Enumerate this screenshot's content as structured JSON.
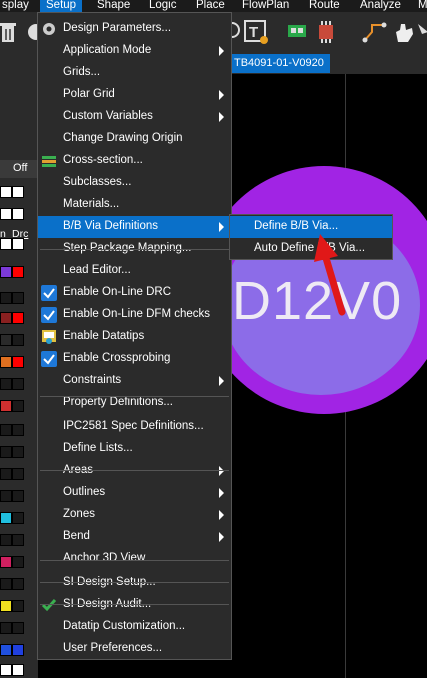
{
  "menubar": {
    "items": [
      "splay",
      "Setup",
      "Shape",
      "Logic",
      "Place",
      "FlowPlan",
      "Route",
      "Analyze",
      "M"
    ],
    "active_index": 1
  },
  "tab": {
    "label": "TB4091-01-V0920"
  },
  "left_panel": {
    "off_label": "Off",
    "header_left": "n",
    "header_right": "Drc"
  },
  "canvas": {
    "via_text": "D12V0"
  },
  "setup_menu": {
    "items": [
      {
        "label": "Design Parameters...",
        "icon": "gear-icon"
      },
      {
        "label": "Application Mode",
        "submenu": true
      },
      {
        "label": "Grids..."
      },
      {
        "label": "Polar Grid",
        "submenu": true
      },
      {
        "label": "Custom Variables",
        "submenu": true
      },
      {
        "label": "Change Drawing Origin"
      },
      {
        "label": "Cross-section...",
        "icon": "cross-section-icon"
      },
      {
        "label": "Subclasses..."
      },
      {
        "label": "Materials..."
      },
      {
        "label": "B/B Via Definitions",
        "submenu": true,
        "highlighted": true
      },
      {
        "label": "Step Package Mapping..."
      },
      {
        "label": "Lead Editor..."
      },
      {
        "label": "Enable On-Line DRC",
        "checked": true
      },
      {
        "label": "Enable On-Line DFM checks",
        "checked": true
      },
      {
        "label": "Enable Datatips",
        "icon": "datatips-icon"
      },
      {
        "label": "Enable Crossprobing",
        "checked": true
      },
      {
        "label": "Constraints",
        "submenu": true
      },
      {
        "label": "Property Definitions..."
      },
      {
        "label": "IPC2581 Spec Definitions..."
      },
      {
        "label": "Define Lists..."
      },
      {
        "label": "Areas",
        "submenu": true
      },
      {
        "label": "Outlines",
        "submenu": true
      },
      {
        "label": "Zones",
        "submenu": true
      },
      {
        "label": "Bend",
        "submenu": true
      },
      {
        "label": "Anchor 3D View"
      },
      {
        "label": "SI Design Setup..."
      },
      {
        "label": "SI Design Audit...",
        "icon": "si-audit-icon"
      },
      {
        "label": "Datatip Customization..."
      },
      {
        "label": "User Preferences..."
      }
    ]
  },
  "bb_via_submenu": {
    "items": [
      {
        "label": "Define B/B Via...",
        "highlighted": true
      },
      {
        "label": "Auto Define B/B Via..."
      }
    ]
  },
  "colors": {
    "accent": "#0a70c9",
    "menu_bg": "#2b2b2b",
    "via_outer": "#a124e4",
    "via_inner": "#8c6ce8",
    "pointer": "#e01818"
  }
}
